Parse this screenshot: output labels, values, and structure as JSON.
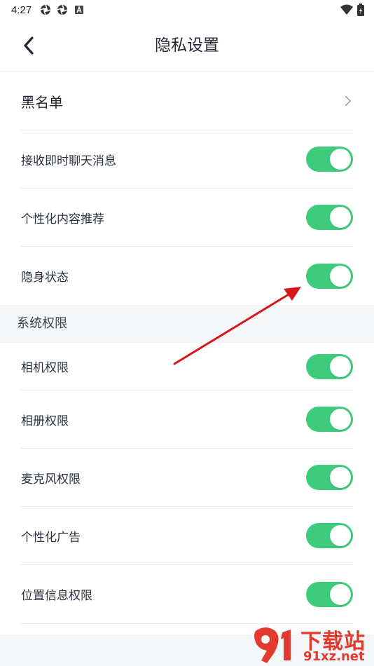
{
  "status_bar": {
    "time": "4:27",
    "icons": [
      "aperture-icon",
      "aperture-icon",
      "notification-a-icon"
    ],
    "right_icons": [
      "wifi-icon",
      "battery-charging-icon"
    ]
  },
  "header": {
    "back_icon": "chevron-left-icon",
    "title": "隐私设置"
  },
  "privacy_items": [
    {
      "label": "黑名单",
      "control": "chevron-right-icon"
    },
    {
      "label": "接收即时聊天消息",
      "control": "toggle",
      "enabled": true
    },
    {
      "label": "个性化内容推荐",
      "control": "toggle",
      "enabled": true
    },
    {
      "label": "隐身状态",
      "control": "toggle",
      "enabled": true
    }
  ],
  "system_section": {
    "title": "系统权限",
    "items": [
      {
        "label": "相机权限",
        "enabled": true
      },
      {
        "label": "相册权限",
        "enabled": true
      },
      {
        "label": "麦克风权限",
        "enabled": true
      },
      {
        "label": "个性化广告",
        "enabled": true
      },
      {
        "label": "位置信息权限",
        "enabled": true
      }
    ]
  },
  "annotation": {
    "type": "red-arrow",
    "color": "#d9161c"
  },
  "colors": {
    "toggle_on": "#3fcb7c",
    "accent_red": "#e23a2e"
  },
  "watermark": {
    "title": "下载站",
    "domain": "91xz.net"
  }
}
